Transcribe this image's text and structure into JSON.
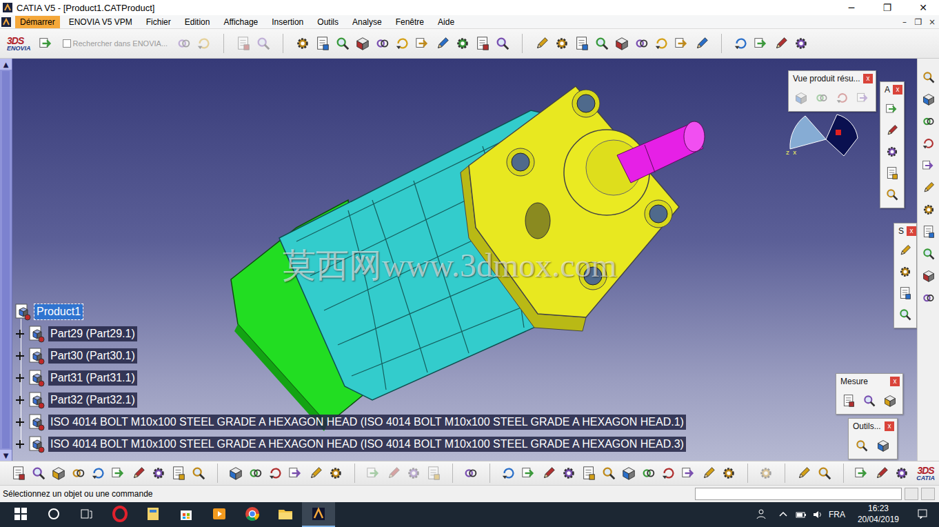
{
  "window": {
    "title": "CATIA V5 - [Product1.CATProduct]",
    "controls": [
      "─",
      "❐",
      "✕"
    ]
  },
  "menu_bar": {
    "items": [
      {
        "label": "Démarrer",
        "highlighted": true
      },
      {
        "label": "ENOVIA V5 VPM",
        "highlighted": false
      },
      {
        "label": "Fichier",
        "highlighted": false
      },
      {
        "label": "Edition",
        "highlighted": false
      },
      {
        "label": "Affichage",
        "highlighted": false
      },
      {
        "label": "Insertion",
        "highlighted": false
      },
      {
        "label": "Outils",
        "highlighted": false
      },
      {
        "label": "Analyse",
        "highlighted": false
      },
      {
        "label": "Fenêtre",
        "highlighted": false
      },
      {
        "label": "Aide",
        "highlighted": false
      }
    ],
    "document_controls": [
      "–",
      "❐",
      "×"
    ]
  },
  "enovia_bar": {
    "logo": {
      "mark": "3DS",
      "name": "ENOVIA"
    },
    "search": {
      "label": "Rechercher dans ENOVIA...",
      "checked": false,
      "disabled": true
    }
  },
  "viewport": {
    "scrollbar": {
      "up": "▲",
      "down": "▼"
    },
    "watermark": "莫西网www.3dmox.com",
    "compass": {
      "axes": [
        "z",
        "x"
      ]
    },
    "tree": [
      {
        "label": "Product1",
        "depth": 0,
        "expanded": true,
        "selected": true
      },
      {
        "label": "Part29 (Part29.1)",
        "depth": 1,
        "expanded": false,
        "selected": false
      },
      {
        "label": "Part30 (Part30.1)",
        "depth": 1,
        "expanded": false,
        "selected": false
      },
      {
        "label": "Part31 (Part31.1)",
        "depth": 1,
        "expanded": false,
        "selected": false
      },
      {
        "label": "Part32 (Part32.1)",
        "depth": 1,
        "expanded": false,
        "selected": false
      },
      {
        "label": "ISO 4014 BOLT M10x100 STEEL GRADE A HEXAGON HEAD (ISO 4014 BOLT M10x100 STEEL GRADE A HEXAGON HEAD.1)",
        "depth": 1,
        "expanded": false,
        "selected": false
      },
      {
        "label": "ISO 4014 BOLT M10x100 STEEL GRADE A HEXAGON HEAD (ISO 4014 BOLT M10x100 STEEL GRADE A HEXAGON HEAD.3)",
        "depth": 1,
        "expanded": false,
        "selected": false
      }
    ]
  },
  "floating_toolbars": [
    {
      "title": "Vue produit résu...",
      "close": "x"
    },
    {
      "title": "A",
      "close": "x"
    },
    {
      "title": "S",
      "close": "x"
    },
    {
      "title": "Mesure",
      "close": "x"
    },
    {
      "title": "Outils...",
      "close": "x"
    }
  ],
  "catia_logo": {
    "mark": "3DS",
    "name": "CATIA"
  },
  "status_bar": {
    "message": "Sélectionnez un objet ou une commande",
    "input": ""
  },
  "taskbar": {
    "language": "FRA",
    "time": "16:23",
    "date": "20/04/2019"
  }
}
